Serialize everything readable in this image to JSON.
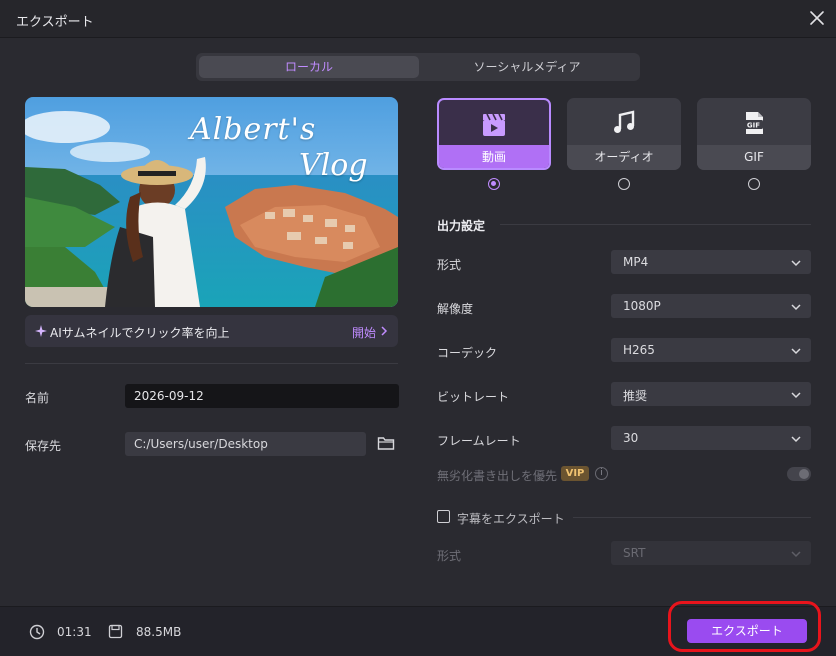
{
  "window": {
    "title": "エクスポート"
  },
  "tabs": [
    {
      "label": "ローカル"
    },
    {
      "label": "ソーシャルメディア"
    }
  ],
  "preview": {
    "overlay_line1": "Albert's",
    "overlay_line2": "Vlog"
  },
  "ai_bar": {
    "label": "AIサムネイルでクリック率を向上",
    "action": "開始"
  },
  "fields": {
    "name_label": "名前",
    "name_value": "2026-09-12",
    "save_label": "保存先",
    "save_value": "C:/Users/user/Desktop"
  },
  "format_cards": [
    {
      "label": "動画",
      "icon": "video-clapper-icon",
      "selected": true
    },
    {
      "label": "オーディオ",
      "icon": "music-note-icon",
      "selected": false
    },
    {
      "label": "GIF",
      "icon": "gif-file-icon",
      "selected": false
    }
  ],
  "output": {
    "section_title": "出力設定",
    "rows": [
      {
        "label": "形式",
        "value": "MP4"
      },
      {
        "label": "解像度",
        "value": "1080P"
      },
      {
        "label": "コーデック",
        "value": "H265"
      },
      {
        "label": "ビットレート",
        "value": "推奨"
      },
      {
        "label": "フレームレート",
        "value": "30"
      }
    ],
    "lossless_label": "無劣化書き出しを優先",
    "vip_badge": "VIP",
    "info_glyph": "i",
    "lossless_enabled": false
  },
  "subtitles": {
    "label": "字幕をエクスポート",
    "format_label": "形式",
    "format_value": "SRT",
    "checked": false
  },
  "footer": {
    "duration": "01:31",
    "size": "88.5MB",
    "export_label": "エクスポート"
  },
  "colors": {
    "accent": "#b070f5",
    "export_button": "#9a4bf0",
    "highlight": "#e8141c",
    "vip": "#f0c270"
  }
}
